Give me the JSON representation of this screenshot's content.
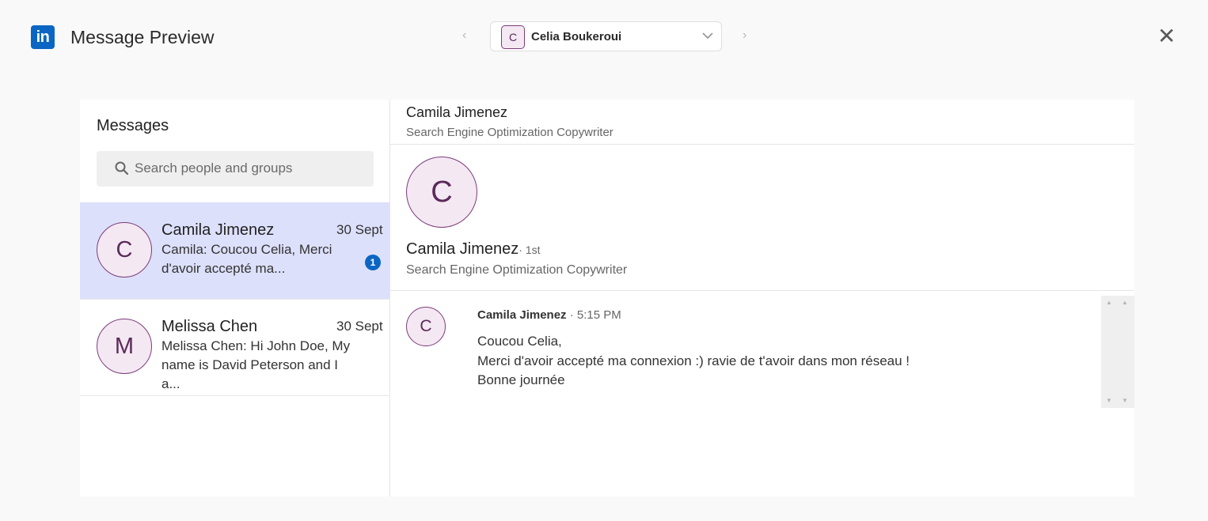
{
  "header": {
    "logo_text": "in",
    "title": "Message Preview",
    "account": {
      "avatar_initial": "C",
      "name": "Celia Boukeroui"
    },
    "prev_icon": "chevron-left-icon",
    "next_icon": "chevron-right-icon",
    "close_icon": "close-icon"
  },
  "sidebar": {
    "title": "Messages",
    "search": {
      "placeholder": "Search people and groups",
      "value": ""
    },
    "conversations": [
      {
        "initial": "C",
        "name": "Camila Jimenez",
        "date": "30 Sept",
        "preview_line1": "Camila: Coucou Celia, Merci",
        "preview_line2": "d'avoir accepté ma...",
        "unread": "1",
        "active": true
      },
      {
        "initial": "M",
        "name": "Melissa Chen",
        "date": "30 Sept",
        "preview_line1": "Melissa Chen: Hi John Doe, My",
        "preview_line2": "name is David Peterson and I a...",
        "active": false
      }
    ]
  },
  "conversation": {
    "header_name": "Camila Jimenez",
    "header_title": "Search Engine Optimization Copywriter",
    "profile": {
      "initial": "C",
      "name": "Camila Jimenez",
      "degree": "· 1st",
      "title": "Search Engine Optimization Copywriter"
    },
    "messages": [
      {
        "initial": "C",
        "sender": "Camila Jimenez",
        "time": " · 5:15 PM",
        "lines": [
          "Coucou Celia,",
          "Merci d'avoir accepté ma connexion :) ravie de t'avoir dans mon réseau !",
          "Bonne journée"
        ]
      }
    ]
  },
  "colors": {
    "brand": "#0a66c2",
    "active_row": "#dde0fb",
    "avatar_border": "#7b3d7a",
    "avatar_fill": "#f4e8f3"
  }
}
